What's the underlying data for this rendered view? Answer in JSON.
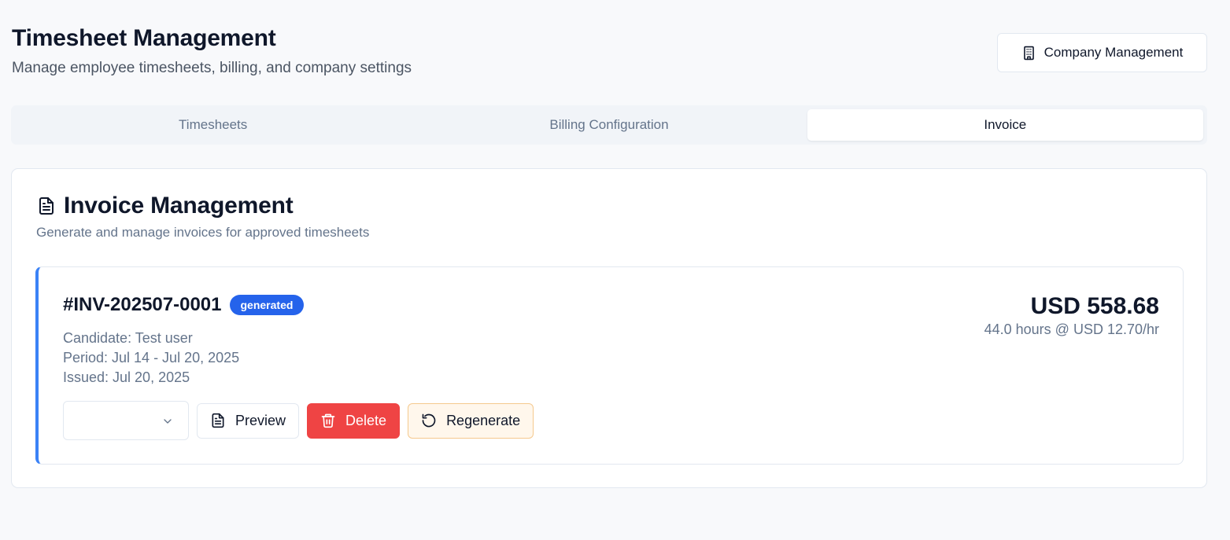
{
  "header": {
    "title": "Timesheet Management",
    "subtitle": "Manage employee timesheets, billing, and company settings"
  },
  "company_button": {
    "label": "Company Management",
    "icon": "building-icon"
  },
  "tabs": [
    {
      "label": "Timesheets",
      "active": false
    },
    {
      "label": "Billing Configuration",
      "active": false
    },
    {
      "label": "Invoice",
      "active": true
    }
  ],
  "invoice_card": {
    "title": "Invoice Management",
    "subtitle": "Generate and manage invoices for approved timesheets",
    "icon": "document-icon"
  },
  "invoice": {
    "number": "#INV-202507-0001",
    "status": "generated",
    "candidate": "Candidate: Test user",
    "period": "Period: Jul 14 - Jul 20, 2025",
    "issued": "Issued: Jul 20, 2025",
    "amount": "USD 558.68",
    "rate_summary": "44.0 hours @ USD 12.70/hr",
    "select_value": "",
    "actions": {
      "preview": "Preview",
      "delete": "Delete",
      "regenerate": "Regenerate"
    }
  },
  "colors": {
    "accent_blue": "#2563eb",
    "border_left": "#3b82f6",
    "delete_red": "#ef4444",
    "regen_bg": "#fff7ec",
    "regen_border": "#f5c98e"
  }
}
